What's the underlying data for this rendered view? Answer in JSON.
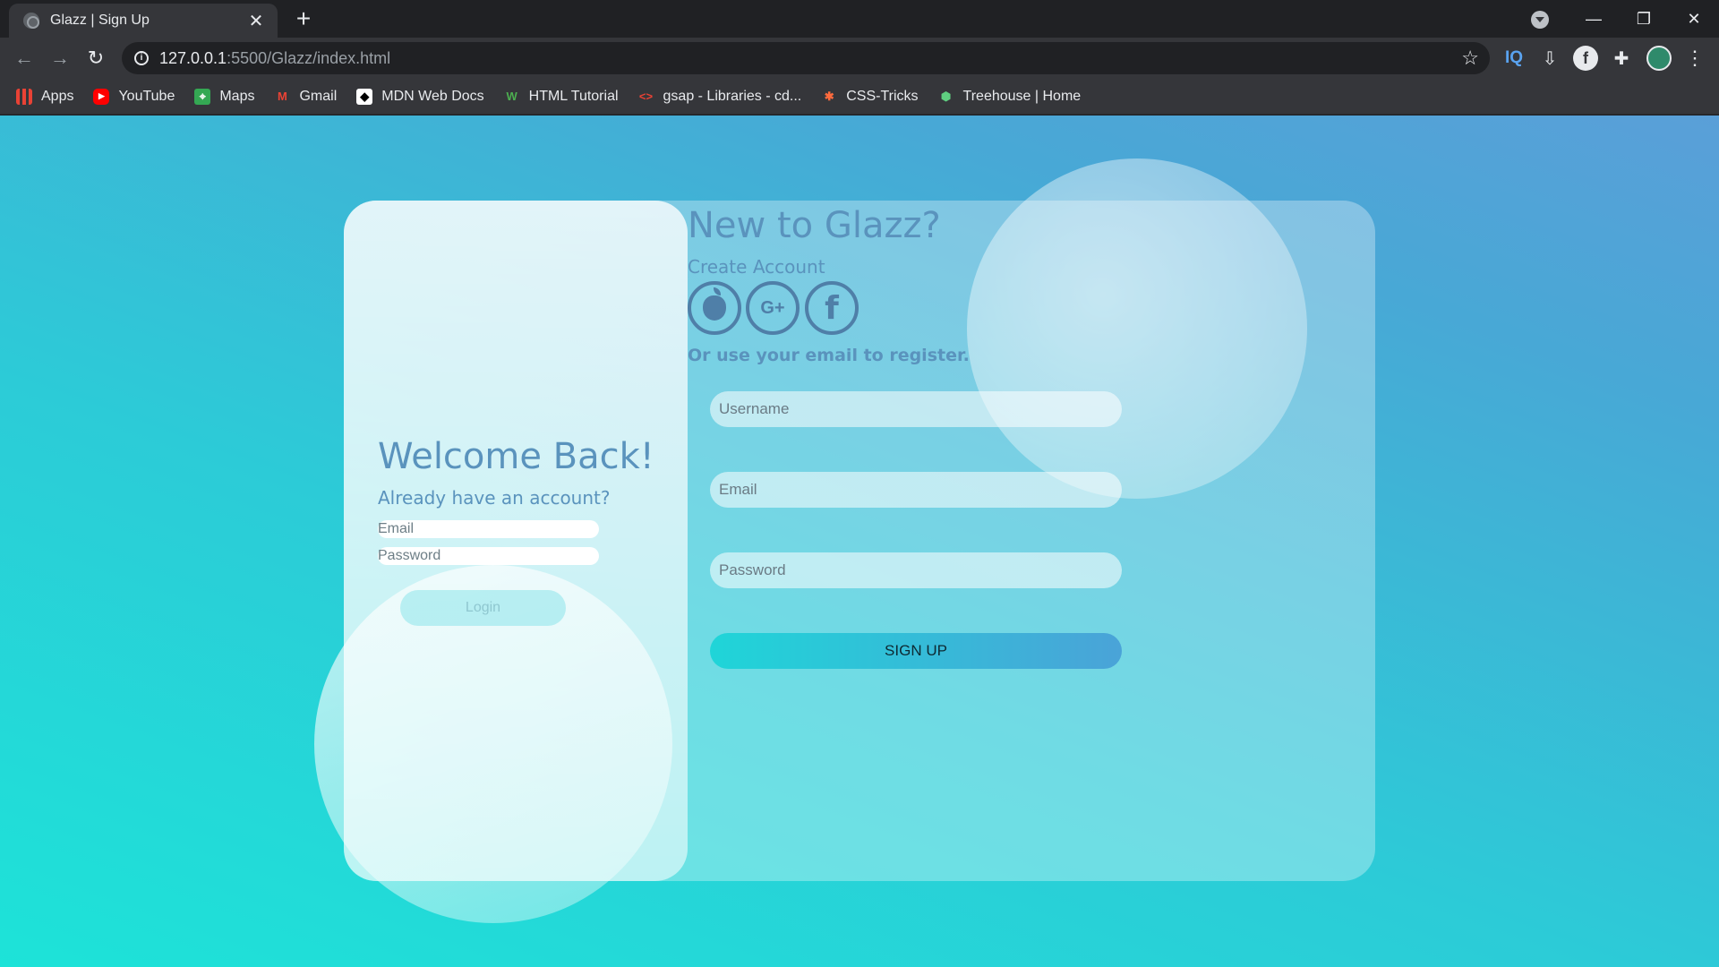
{
  "browser": {
    "tab_title": "Glazz | Sign Up",
    "tab_close": "✕",
    "new_tab": "+",
    "url_host": "127.0.0.1",
    "url_path": ":5500/Glazz/index.html",
    "window_controls": {
      "minimize": "—",
      "restore": "❐",
      "close": "✕"
    },
    "nav": {
      "back": "←",
      "forward": "→",
      "reload": "↻"
    },
    "star": "☆",
    "extensions": {
      "iq": "IQ",
      "download": "⇩",
      "fb": "f",
      "puzzle": "✚",
      "menu": "⋮"
    },
    "bookmarks": [
      {
        "label": "Apps",
        "icon": "apps-icon"
      },
      {
        "label": "YouTube",
        "icon": "youtube-icon"
      },
      {
        "label": "Maps",
        "icon": "maps-icon"
      },
      {
        "label": "Gmail",
        "icon": "gmail-icon"
      },
      {
        "label": "MDN Web Docs",
        "icon": "mdn-icon"
      },
      {
        "label": "HTML Tutorial",
        "icon": "w3schools-icon"
      },
      {
        "label": "gsap - Libraries - cd...",
        "icon": "code-icon"
      },
      {
        "label": "CSS-Tricks",
        "icon": "css-tricks-icon"
      },
      {
        "label": "Treehouse | Home",
        "icon": "treehouse-icon"
      }
    ]
  },
  "login": {
    "heading": "Welcome Back!",
    "subheading": "Already have an account?",
    "email_placeholder": "Email",
    "password_placeholder": "Password",
    "button": "Login"
  },
  "signup": {
    "heading": "New to Glazz?",
    "subheading": "Create Account",
    "social": {
      "apple": "apple-icon",
      "google": "G+",
      "facebook": "f"
    },
    "or_text": "Or use your email to register.",
    "username_placeholder": "Username",
    "email_placeholder": "Email",
    "password_placeholder": "Password",
    "button": "SIGN UP"
  },
  "colors": {
    "accent_text": "#5a93bd",
    "bg_start": "#1de3d8",
    "bg_end": "#5a9fd8"
  }
}
